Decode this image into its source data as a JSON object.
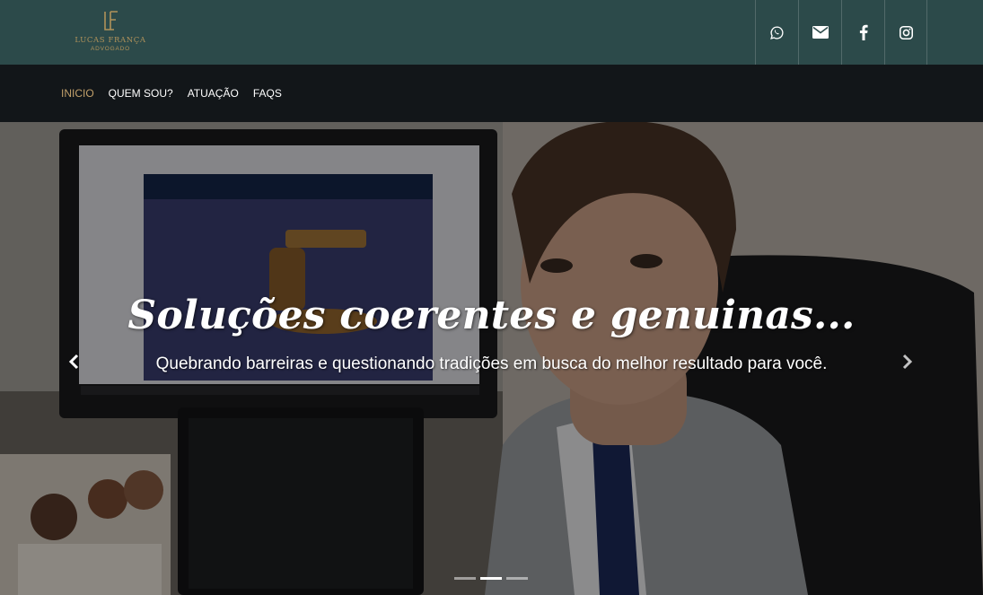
{
  "brand": {
    "monogram": "LF",
    "name": "LUCAS FRANÇA",
    "subtitle": "ADVOGADO"
  },
  "social": [
    {
      "icon": "whatsapp-icon"
    },
    {
      "icon": "envelope-icon"
    },
    {
      "icon": "facebook-icon"
    },
    {
      "icon": "instagram-icon"
    }
  ],
  "nav": {
    "items": [
      {
        "label": "INICIO",
        "active": true
      },
      {
        "label": "QUEM SOU?",
        "active": false
      },
      {
        "label": "ATUAÇÃO",
        "active": false
      },
      {
        "label": "FAQS",
        "active": false
      }
    ]
  },
  "hero": {
    "title": "Soluções coerentes e genuinas...",
    "subtitle": "Quebrando barreiras e questionando tradições em busca do melhor resultado para você.",
    "slides": 3,
    "active_slide": 2
  },
  "colors": {
    "topbar": "#2c4a4a",
    "navbar": "#121619",
    "accent": "#c2a06a"
  }
}
